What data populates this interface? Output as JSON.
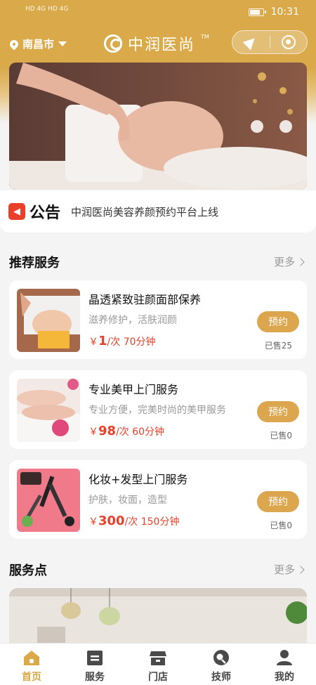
{
  "status": {
    "time": "10:31",
    "left_indicators": "HD 4G HD 4G"
  },
  "header": {
    "city": "南昌市",
    "logo_text": "中润医尚",
    "logo_tm": "TM"
  },
  "notice": {
    "tag": "公告",
    "message": "中润医尚美容养颜预约平台上线"
  },
  "recommend": {
    "title": "推荐服务",
    "more": "更多",
    "items": [
      {
        "name": "晶透紧致驻颜面部保养",
        "desc": "滋养修护，活肤润颜",
        "currency": "￥",
        "price": "1",
        "unit": "/次 70分钟",
        "book": "预约",
        "sold": "已售25"
      },
      {
        "name": "专业美甲上门服务",
        "desc": "专业方便，完美时尚的美甲服务",
        "currency": "￥",
        "price": "98",
        "unit": "/次 60分钟",
        "book": "预约",
        "sold": "已售0"
      },
      {
        "name": "化妆+发型上门服务",
        "desc": "护肤，妆面，造型",
        "currency": "￥",
        "price": "300",
        "unit": "/次 150分钟",
        "book": "预约",
        "sold": "已售0"
      }
    ]
  },
  "stores": {
    "title": "服务点",
    "more": "更多"
  },
  "tabbar": {
    "active_color": "#d9a94a",
    "items": [
      {
        "label": "首页",
        "icon": "home-icon"
      },
      {
        "label": "服务",
        "icon": "service-icon"
      },
      {
        "label": "门店",
        "icon": "store-icon"
      },
      {
        "label": "技师",
        "icon": "technician-icon"
      },
      {
        "label": "我的",
        "icon": "profile-icon"
      }
    ]
  }
}
